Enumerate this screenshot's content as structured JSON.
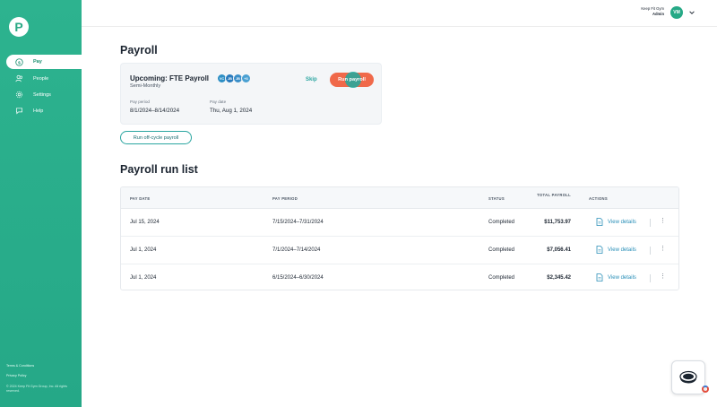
{
  "app": {
    "logo_letter": "P"
  },
  "sidebar": {
    "items": [
      {
        "label": "Pay",
        "icon": "dollar-circle-icon",
        "active": true
      },
      {
        "label": "People",
        "icon": "people-icon",
        "active": false
      },
      {
        "label": "Settings",
        "icon": "gear-icon",
        "active": false
      },
      {
        "label": "Help",
        "icon": "help-chat-icon",
        "active": false
      }
    ],
    "footer": {
      "terms": "Terms & Conditions",
      "privacy": "Privacy Policy",
      "copyright": "© 2024 Keep Fit Gym Group, Inc. All rights reserved."
    }
  },
  "header": {
    "company": "Keep Fit Gym",
    "role": "Admin",
    "avatar_initials": "VM"
  },
  "page": {
    "title": "Payroll"
  },
  "upcoming": {
    "title": "Upcoming: FTE Payroll",
    "frequency": "Semi-Monthly",
    "chips": [
      "VC",
      "JB",
      "JB",
      "+3"
    ],
    "skip_label": "Skip",
    "run_label": "Run payroll",
    "pay_period_label": "Pay period",
    "pay_period_value": "8/1/2024–8/14/2024",
    "pay_date_label": "Pay date",
    "pay_date_value": "Thu, Aug 1, 2024"
  },
  "offcycle_label": "Run off-cycle payroll",
  "run_list": {
    "title": "Payroll run list",
    "columns": {
      "pay_date": "PAY DATE",
      "pay_period": "PAY PERIOD",
      "status": "STATUS",
      "total": "TOTAL PAYROLL",
      "actions": "ACTIONS"
    },
    "rows": [
      {
        "pay_date": "Jul 15, 2024",
        "pay_period": "7/15/2024–7/31/2024",
        "status": "Completed",
        "total": "$11,753.97",
        "action": "View details"
      },
      {
        "pay_date": "Jul 1, 2024",
        "pay_period": "7/1/2024–7/14/2024",
        "status": "Completed",
        "total": "$7,056.41",
        "action": "View details"
      },
      {
        "pay_date": "Jul 1, 2024",
        "pay_period": "6/15/2024–6/30/2024",
        "status": "Completed",
        "total": "$2,345.42",
        "action": "View details"
      }
    ]
  },
  "colors": {
    "brand_green": "#2db38f",
    "accent_orange": "#f0694a",
    "link_blue": "#2a8fb8"
  }
}
